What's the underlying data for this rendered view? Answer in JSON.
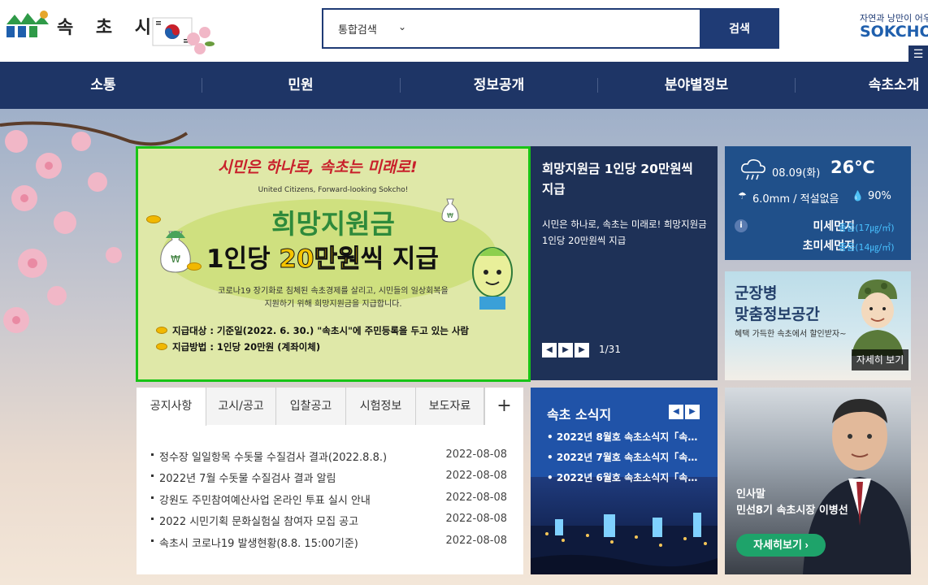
{
  "header": {
    "logo_text": "속 초 시",
    "search_type": "통합검색",
    "search_placeholder": "",
    "search_button": "검색",
    "slogan": "자연과 낭만이 어우러",
    "city_name": "SOKCHO"
  },
  "nav": {
    "items": [
      "소통",
      "민원",
      "정보공개",
      "분야별정보",
      "속초소개"
    ]
  },
  "main_banner": {
    "slogan": "시민은 하나로, 속초는 미래로!",
    "slogan_en": "United Citizens, Forward-looking Sokcho!",
    "title_line1": "희망지원금",
    "title_line2_pre": "1인당 ",
    "title_line2_highlight": "20만원",
    "title_line2_post": "씩 지급",
    "desc_line1": "코로나19 장기화로 침체된 속초경제를 살리고, 시민들의 일상회복을",
    "desc_line2": "지원하기 위해 희망지원금을 지급합니다.",
    "target": "지급대상 : 기준일(2022. 6. 30.) \"속초시\"에 주민등록을 두고 있는 사람",
    "method": "지급방법 : 1인당 20만원 (계좌이체)"
  },
  "slide_panel": {
    "title": "희망지원금 1인당 20만원씩 지급",
    "desc": "시민은 하나로, 속초는 미래로! 희망지원금 1인당 20만원씩 지급",
    "counter": "1/31"
  },
  "weather": {
    "date": "08.09(화)",
    "temp": "26℃",
    "rain": "6.0mm / 적설없음",
    "humidity": "90%",
    "dust_label": "미세먼지",
    "dust_value": "좋음(17㎍/㎥)",
    "fine_dust_label": "초미세먼지",
    "fine_dust_value": "좋음(14㎍/㎥)"
  },
  "soldier_banner": {
    "title_line1": "군장병",
    "title_line2": "맞춤정보공간",
    "sub": "혜택 가득한 속초에서 할인받자~",
    "more": "자세히 보기"
  },
  "notice": {
    "tabs": [
      "공지사항",
      "고시/공고",
      "입찰공고",
      "시험정보",
      "보도자료"
    ],
    "add_label": "+",
    "items": [
      {
        "title": "정수장 일일항목 수돗물 수질검사 결과(2022.8.8.)",
        "date": "2022-08-08"
      },
      {
        "title": "2022년 7월 수돗물 수질검사 결과 알림",
        "date": "2022-08-08"
      },
      {
        "title": "강원도 주민참여예산사업 온라인 투표 실시 안내",
        "date": "2022-08-08"
      },
      {
        "title": "2022 시민기획 문화실험실 참여자 모집 공고",
        "date": "2022-08-08"
      },
      {
        "title": "속초시 코로나19 발생현황(8.8. 15:00기준)",
        "date": "2022-08-08"
      }
    ]
  },
  "sokcho_news": {
    "title": "속초 소식지",
    "items": [
      "2022년 8월호 속초소식지「속…",
      "2022년 7월호 속초소식지「속…",
      "2022년 6월호 속초소식지「속…"
    ]
  },
  "mayor": {
    "label": "인사말",
    "name": "민선8기 속초시장 이병선",
    "more": "자세히보기"
  },
  "colors": {
    "navy": "#1e3566",
    "search_navy": "#1f3b75",
    "banner_border": "#18c416",
    "weather_blue": "#20508a",
    "dust_good": "#49c1ff",
    "mayor_green": "#1ea36a"
  }
}
